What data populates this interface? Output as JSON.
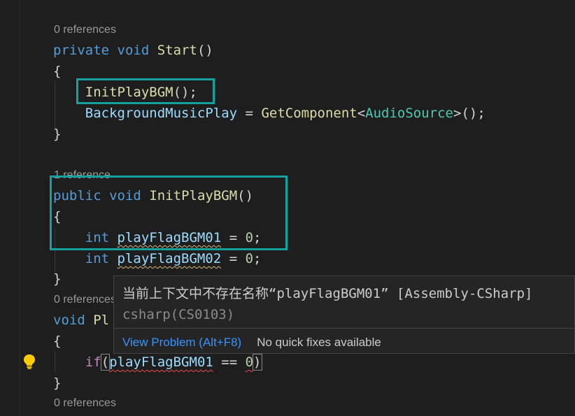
{
  "codelens": {
    "start": "0 references",
    "init": "1 reference",
    "play": "0 references",
    "bottom": "0 references"
  },
  "code": {
    "l1": {
      "kw1": "private",
      "kw2": "void",
      "fn": "Start",
      "rest": "()"
    },
    "l2": "{",
    "l3": {
      "fn": "InitPlayBGM",
      "rest": "();"
    },
    "l4": {
      "var": "BackgroundMusicPlay",
      "eq": " = ",
      "fn": "GetComponent",
      "lt": "<",
      "type": "AudioSource",
      "gt": ">();"
    },
    "l5": "}",
    "l6": {
      "kw1": "public",
      "kw2": "void",
      "fn": "InitPlayBGM",
      "rest": "()"
    },
    "l7": "{",
    "l8": {
      "kw": "int",
      "var": "playFlagBGM01",
      "eq": " = ",
      "num": "0",
      "semi": ";"
    },
    "l9": {
      "kw": "int",
      "var": "playFlagBGM02",
      "eq": " = ",
      "num": "0",
      "semi": ";"
    },
    "l10": "}",
    "l11": {
      "kw": "void",
      "fn": "Pl"
    },
    "l12": "{",
    "l13": {
      "ctrl": "if",
      "open": "(",
      "var": "playFlagBGM01",
      "op": " == ",
      "num": "0",
      "close": ")"
    },
    "l14": "}"
  },
  "hover": {
    "message": "当前上下文中不存在名称“playFlagBGM01” [Assembly-CSharp]",
    "source": "csharp(CS0103)",
    "view_problem": "View Problem (Alt+F8)",
    "no_fixes": "No quick fixes available"
  },
  "colors": {
    "highlight_box": "#16a19e",
    "background": "#1e1e1e"
  },
  "icons": {
    "bulb": "lightbulb-icon"
  }
}
